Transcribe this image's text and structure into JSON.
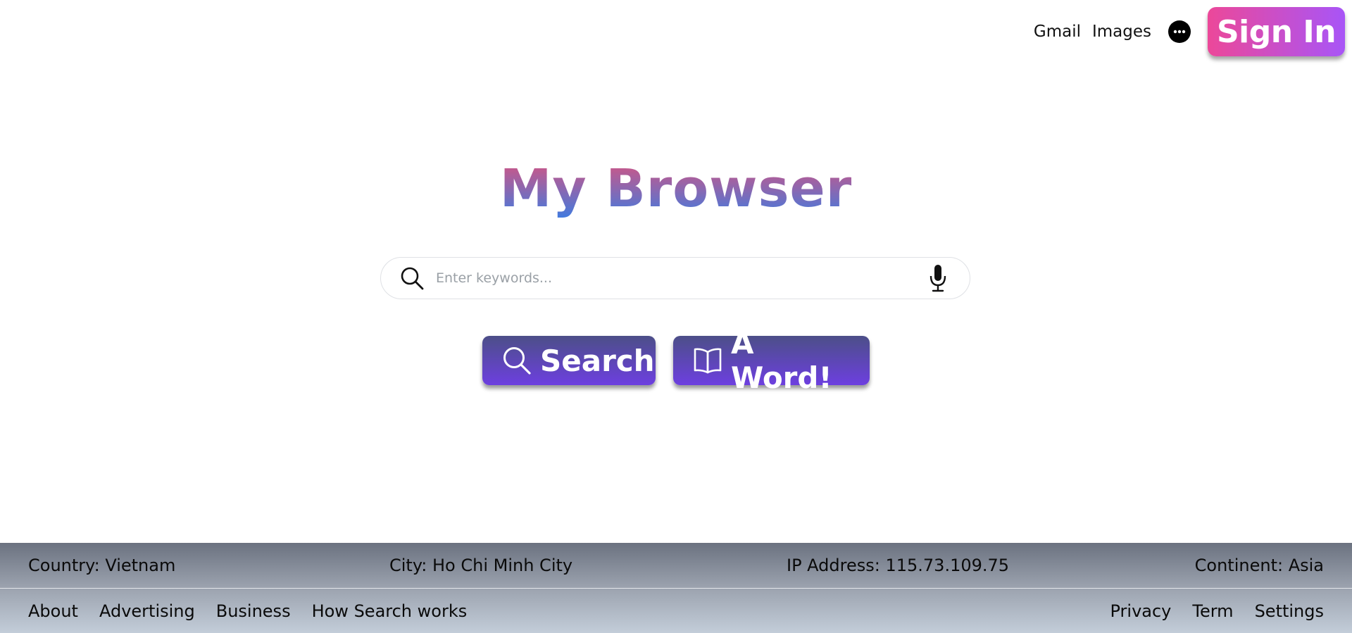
{
  "header": {
    "links": {
      "gmail": "Gmail",
      "images": "Images"
    },
    "more_icon": "more-horizontal-icon",
    "signin_label": "Sign In"
  },
  "logo": {
    "text": "My Browser"
  },
  "search": {
    "placeholder": "Enter keywords...",
    "value": "",
    "left_icon": "search-icon",
    "right_icon": "microphone-icon"
  },
  "actions": {
    "search_label": "Search",
    "word_label": "A Word!"
  },
  "footer": {
    "info": {
      "country": "Country: Vietnam",
      "city": "City: Ho Chi Minh City",
      "ip": "IP Address: 115.73.109.75",
      "continent": "Continent: Asia"
    },
    "left_links": [
      "About",
      "Advertising",
      "Business",
      "How Search works"
    ],
    "right_links": [
      "Privacy",
      "Term",
      "Settings"
    ]
  },
  "colors": {
    "signin_gradient": [
      "#ec4899",
      "#a855f7"
    ],
    "action_gradient": [
      "#4c4f88",
      "#6d3fe0"
    ],
    "logo_gradient": [
      "#d9537f",
      "#3f7be0"
    ],
    "footer_top": "#6b7280",
    "footer_bottom": "#c3cdd9"
  }
}
